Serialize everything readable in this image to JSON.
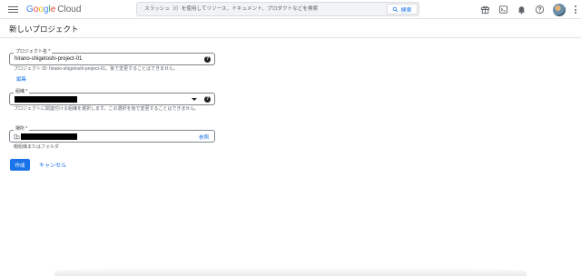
{
  "header": {
    "logo_google": [
      "G",
      "o",
      "o",
      "g",
      "l",
      "e"
    ],
    "logo_cloud": "Cloud",
    "search_placeholder": "スラッシュ（/）を使用してリソース、ドキュメント、プロダクトなどを検索",
    "search_button": "検索",
    "icons": [
      "menu-icon",
      "gift-icon",
      "cloud-shell-icon",
      "notifications-icon",
      "help-icon",
      "avatar",
      "more-options-icon"
    ]
  },
  "page": {
    "title": "新しいプロジェクト"
  },
  "form": {
    "project_name": {
      "label": "プロジェクト名 *",
      "value": "hirano-shigetoshi-project-01",
      "hint": "プロジェクト ID: hirano-shigetoshi-project-01。後で変更することはできません。",
      "edit_link": "編集"
    },
    "organization": {
      "label": "組織 *",
      "hint": "プロジェクトに関連付ける組織を選択します。この選択を後で変更することはできません。"
    },
    "location": {
      "label": "場所 *",
      "browse_link": "参照",
      "hint": "親組織またはフォルダ"
    }
  },
  "actions": {
    "create": "作成",
    "cancel": "キャンセル"
  },
  "colors": {
    "accent": "#1a73e8",
    "text": "#202124",
    "hint": "#5f6368"
  }
}
